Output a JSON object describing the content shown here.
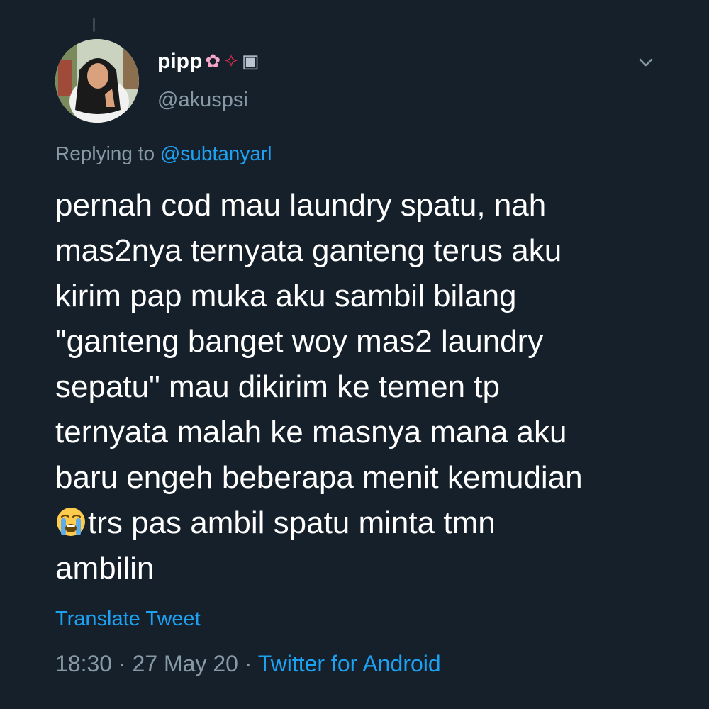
{
  "author": {
    "display_name": "pipp",
    "name_emojis": [
      "✿",
      "✧",
      "▣"
    ],
    "handle": "@akuspsi"
  },
  "reply": {
    "prefix": "Replying to",
    "mention": "@subtanyarl"
  },
  "tweet": {
    "lines": [
      "pernah cod mau laundry spatu, nah",
      "mas2nya ternyata ganteng terus aku",
      "kirim pap muka aku sambil bilang",
      "\"ganteng banget woy mas2 laundry",
      "sepatu\" mau dikirim ke temen tp",
      "ternyata malah ke masnya mana aku",
      "baru engeh beberapa menit kemudian",
      "trs pas ambil spatu minta tmn",
      "ambilin"
    ],
    "emoji": "loudly-crying-face"
  },
  "translate_label": "Translate Tweet",
  "meta": {
    "time": "18:30",
    "separator": "·",
    "date": "27 May 20",
    "source": "Twitter for Android"
  },
  "colors": {
    "background": "#15202b",
    "text": "#ffffff",
    "secondary": "#8899a6",
    "accent": "#1da1f2"
  }
}
